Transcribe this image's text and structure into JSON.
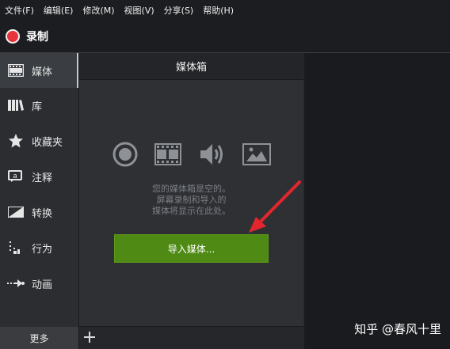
{
  "menu": [
    "文件(F)",
    "编辑(E)",
    "修改(M)",
    "视图(V)",
    "分享(S)",
    "帮助(H)"
  ],
  "record": {
    "label": "录制"
  },
  "sidebar": {
    "items": [
      {
        "label": "媒体",
        "icon": "film-strip-icon",
        "active": true
      },
      {
        "label": "库",
        "icon": "library-books-icon"
      },
      {
        "label": "收藏夹",
        "icon": "star-icon"
      },
      {
        "label": "注释",
        "icon": "annotation-bubble-icon"
      },
      {
        "label": "转换",
        "icon": "transition-icon"
      },
      {
        "label": "行为",
        "icon": "behavior-icon"
      },
      {
        "label": "动画",
        "icon": "animation-arrow-icon"
      }
    ],
    "more": "更多"
  },
  "media_bin": {
    "title": "媒体箱",
    "empty_lines": [
      "您的媒体箱是空的。",
      "屏幕录制和导入的",
      "媒体将显示在此处。"
    ],
    "import_button": "导入媒体..."
  },
  "watermark": "知乎 @春风十里",
  "colors": {
    "record": "#e8333a",
    "import_button": "#4f8a15",
    "annotation_arrow": "#e3262e"
  }
}
